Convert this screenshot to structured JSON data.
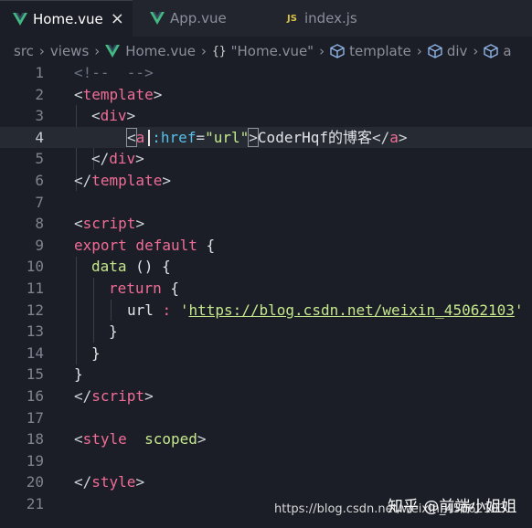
{
  "tabs": [
    {
      "label": "Home.vue",
      "active": true,
      "icon": "vue-icon",
      "close": "×"
    },
    {
      "label": "App.vue",
      "active": false,
      "icon": "vue-icon"
    },
    {
      "label": "index.js",
      "active": false,
      "icon": "js-icon",
      "badge": "JS"
    }
  ],
  "breadcrumb": {
    "items": [
      "src",
      "views",
      "Home.vue",
      "\"Home.vue\"",
      "template",
      "div",
      "a"
    ],
    "braces": "{}"
  },
  "editor": {
    "current_line": 4,
    "line_numbers": [
      "1",
      "2",
      "3",
      "4",
      "5",
      "6",
      "7",
      "8",
      "9",
      "10",
      "11",
      "12",
      "13",
      "14",
      "15",
      "16",
      "17",
      "18",
      "19",
      "20",
      "21"
    ],
    "lines": {
      "l1": {
        "a": "<!--",
        "b": "  -->"
      },
      "l2": {
        "a": "<",
        "b": "template",
        "c": ">"
      },
      "l3": {
        "a": "<",
        "b": "div",
        "c": ">"
      },
      "l4": {
        "a": "<",
        "b": "a",
        "c": ":href",
        "d": "=",
        "e": "\"",
        "f": "url",
        "g": "\"",
        "h": ">",
        "i": "CoderHqf的博客",
        "j": "</",
        "k": "a",
        "l": ">"
      },
      "l5": {
        "a": "</",
        "b": "div",
        "c": ">"
      },
      "l6": {
        "a": "</",
        "b": "template",
        "c": ">"
      },
      "l8": {
        "a": "<",
        "b": "script",
        "c": ">"
      },
      "l9": {
        "a": "export",
        "b": " default",
        "c": " {"
      },
      "l10": {
        "a": "data",
        "b": " () {"
      },
      "l11": {
        "a": "return",
        "b": " {"
      },
      "l12": {
        "a": "url",
        "b": " : ",
        "c": "'",
        "d": "https://blog.csdn.net/weixin_45062103",
        "e": "'"
      },
      "l13": {
        "a": "}"
      },
      "l14": {
        "a": "}"
      },
      "l15": {
        "a": "}"
      },
      "l16": {
        "a": "</",
        "b": "script",
        "c": ">"
      },
      "l18": {
        "a": "<",
        "b": "style",
        "c": "  scoped",
        "d": ">"
      },
      "l20": {
        "a": "</",
        "b": "style",
        "c": ">"
      }
    }
  },
  "watermark": {
    "brand": "知乎 @前端小姐姐",
    "url": "https://blog.csdn.net/weixin_45062103"
  },
  "colors": {
    "background": "#1b1e26",
    "tag": "#f06d97",
    "attribute": "#56c0e8",
    "string": "#c6e88d",
    "line_number": "#7e838d"
  }
}
